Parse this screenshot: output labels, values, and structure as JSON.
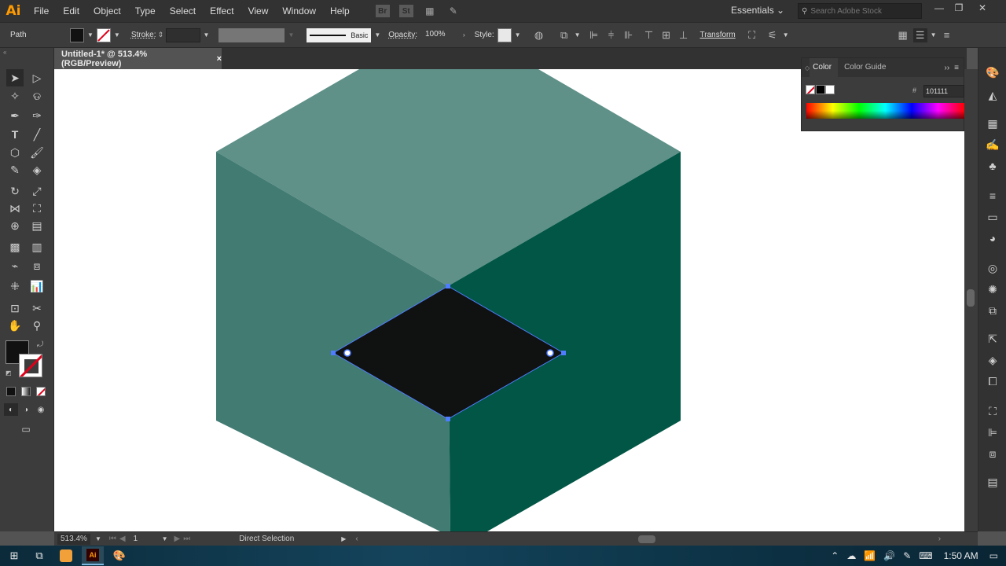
{
  "app": {
    "logo": "Ai"
  },
  "menu": [
    "File",
    "Edit",
    "Object",
    "Type",
    "Select",
    "Effect",
    "View",
    "Window",
    "Help"
  ],
  "menubar_icons": {
    "br": "Br",
    "st": "St"
  },
  "workspace": {
    "label": "Essentials"
  },
  "search": {
    "placeholder": "Search Adobe Stock"
  },
  "control": {
    "selection_type": "Path",
    "stroke_label": "Stroke:",
    "stroke_style": "Basic",
    "opacity_label": "Opacity:",
    "opacity_value": "100%",
    "style_label": "Style:",
    "transform_label": "Transform"
  },
  "document_tab": {
    "title": "Untitled-1* @ 513.4% (RGB/Preview)",
    "close": "×"
  },
  "color_panel": {
    "tabs": [
      "Color",
      "Color Guide"
    ],
    "hash": "#",
    "hex_value": "101111"
  },
  "statusbar": {
    "zoom": "513.4%",
    "artboard": "1",
    "tool": "Direct Selection"
  },
  "taskbar": {
    "time": "1:50 AM"
  },
  "colors": {
    "cube_top": "#5f9189",
    "cube_left": "#417b72",
    "cube_right": "#025645",
    "diamond": "#101111",
    "selection": "#4e7dff"
  }
}
